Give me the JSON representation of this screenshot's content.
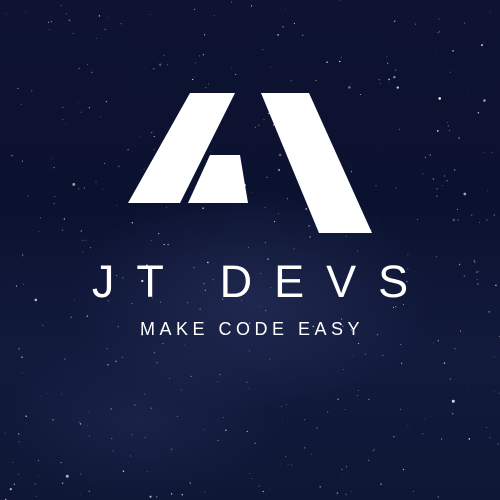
{
  "logo": {
    "icon": "stylized-a-mark-icon",
    "brand_name": "JT DEVS",
    "tagline": "MAKE CODE EASY"
  },
  "colors": {
    "background": "#0d1330",
    "foreground": "#ffffff"
  }
}
